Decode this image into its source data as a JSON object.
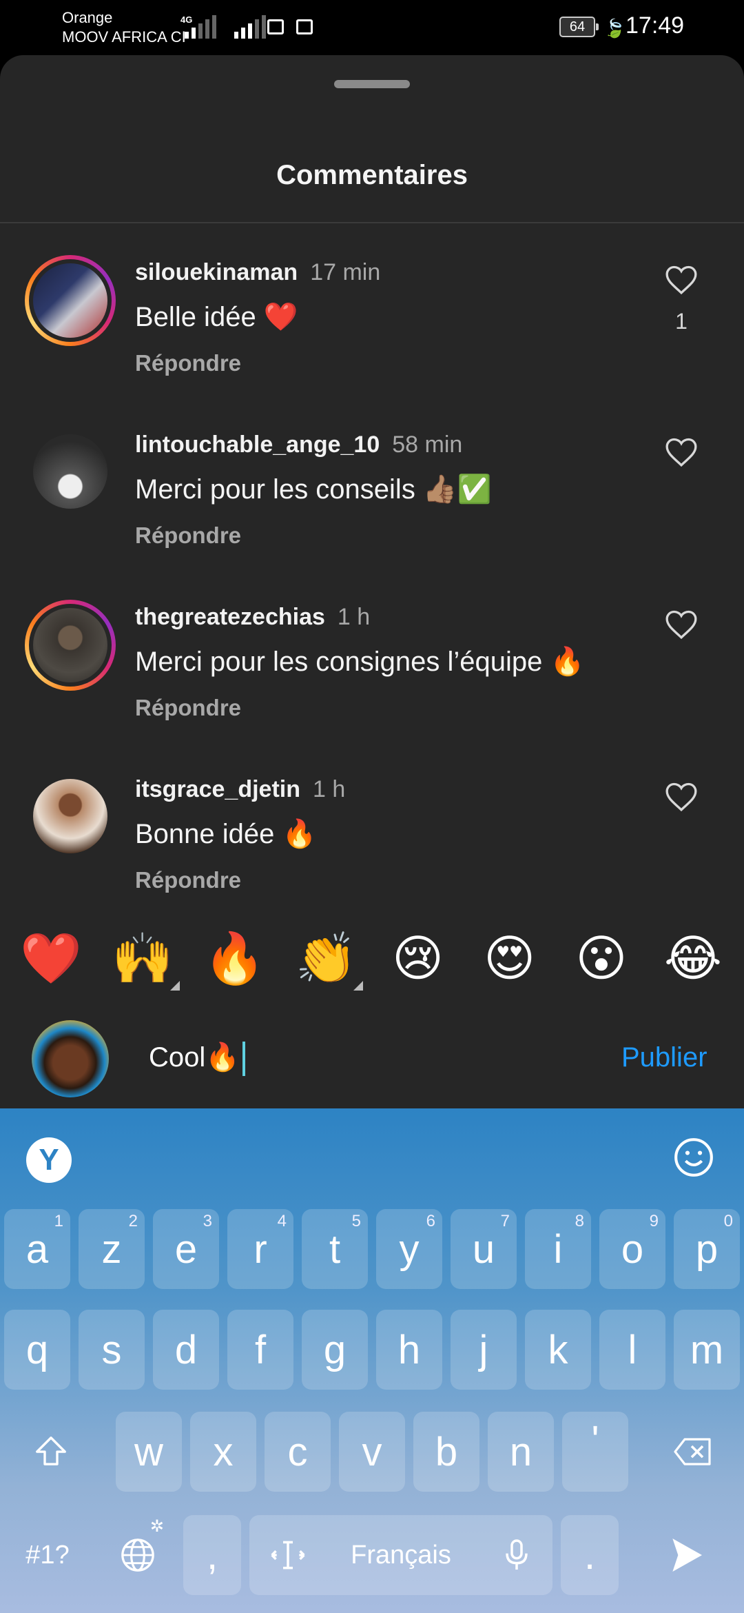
{
  "status_bar": {
    "carrier1": "Orange",
    "carrier2": "MOOV AFRICA CI",
    "network": "4G",
    "battery": "64",
    "time": "17:49"
  },
  "sheet": {
    "title": "Commentaires"
  },
  "comments": [
    {
      "username": "silouekinaman",
      "time": "17 min",
      "text": "Belle idée ❤️",
      "reply": "Répondre",
      "likes": "1"
    },
    {
      "username": "lintouchable_ange_10",
      "time": "58 min",
      "text": "Merci pour les conseils 👍🏽✅",
      "reply": "Répondre"
    },
    {
      "username": "thegreatezechias",
      "time": "1 h",
      "text": "Merci pour les consignes l’équipe 🔥",
      "reply": "Répondre"
    },
    {
      "username": "itsgrace_djetin",
      "time": "1 h",
      "text": "Bonne idée 🔥",
      "reply": "Répondre"
    }
  ],
  "emoji_bar": [
    "❤️",
    "🙌",
    "🔥",
    "👏",
    "😢",
    "😍",
    "😮",
    "😂"
  ],
  "composer": {
    "value": "Cool🔥",
    "publish": "Publier"
  },
  "keyboard": {
    "logo": "Y",
    "row1": [
      [
        "a",
        "1"
      ],
      [
        "z",
        "2"
      ],
      [
        "e",
        "3"
      ],
      [
        "r",
        "4"
      ],
      [
        "t",
        "5"
      ],
      [
        "y",
        "6"
      ],
      [
        "u",
        "7"
      ],
      [
        "i",
        "8"
      ],
      [
        "o",
        "9"
      ],
      [
        "p",
        "0"
      ]
    ],
    "row2": [
      "q",
      "s",
      "d",
      "f",
      "g",
      "h",
      "j",
      "k",
      "l",
      "m"
    ],
    "row3": [
      "w",
      "x",
      "c",
      "v",
      "b",
      "n",
      "'"
    ],
    "symbols": "#1?",
    "comma": ",",
    "space": "Français",
    "period": "."
  },
  "icons": {
    "heart": "heart-outline-icon",
    "shift": "shift-icon",
    "backspace": "backspace-icon",
    "globe": "globe-icon",
    "cursor": "cursor-move-icon",
    "mic": "microphone-icon",
    "send": "send-icon",
    "emoji": "emoji-icon"
  }
}
